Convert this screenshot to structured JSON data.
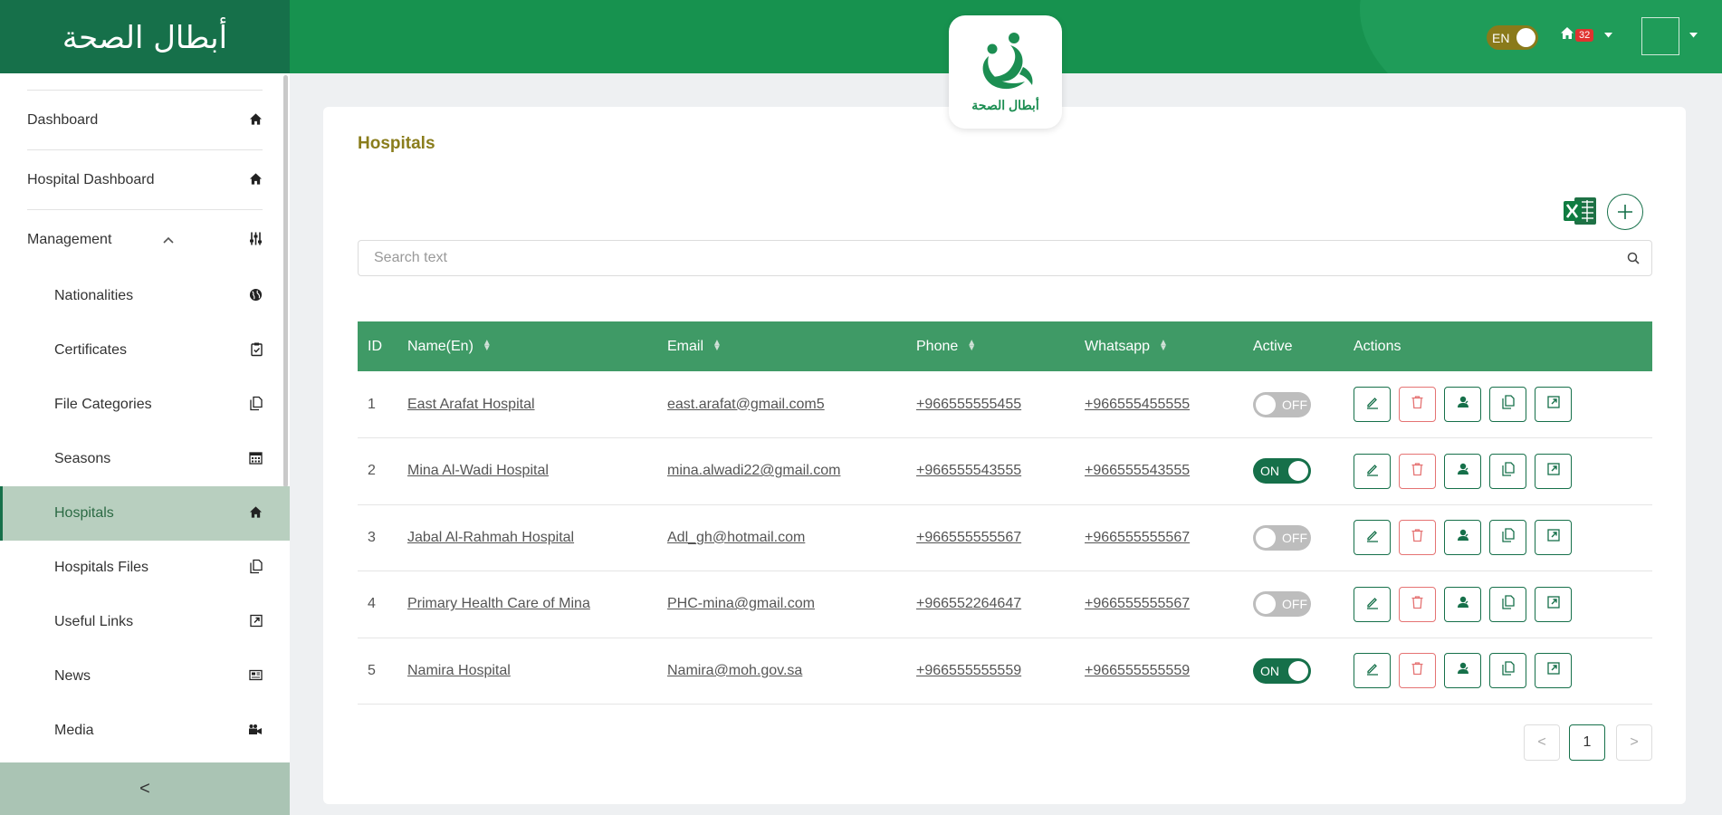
{
  "brand": {
    "logo_text": "أبطال الصحة"
  },
  "header": {
    "center_logo_text": "أبطال الصحة",
    "lang_label": "EN",
    "notification_count": "32"
  },
  "sidebar": {
    "items": [
      {
        "label": "Dashboard",
        "icon": "home-icon"
      },
      {
        "label": "Hospital Dashboard",
        "icon": "home-icon"
      },
      {
        "label": "Management",
        "icon": "sliders-icon",
        "expanded": true
      }
    ],
    "sub_items": [
      {
        "label": "Nationalities",
        "icon": "globe-icon"
      },
      {
        "label": "Certificates",
        "icon": "clipboard-check-icon"
      },
      {
        "label": "File Categories",
        "icon": "files-icon"
      },
      {
        "label": "Seasons",
        "icon": "calendar-icon"
      },
      {
        "label": "Hospitals",
        "icon": "home-icon",
        "active": true
      },
      {
        "label": "Hospitals Files",
        "icon": "files-icon"
      },
      {
        "label": "Useful Links",
        "icon": "external-link-icon"
      },
      {
        "label": "News",
        "icon": "newspaper-icon"
      },
      {
        "label": "Media",
        "icon": "video-camera-icon"
      }
    ],
    "collapse_label": "<"
  },
  "main": {
    "title": "Hospitals",
    "search": {
      "placeholder": "Search text",
      "value": ""
    },
    "table": {
      "columns": [
        "ID",
        "Name(En)",
        "Email",
        "Phone",
        "Whatsapp",
        "Active",
        "Actions"
      ],
      "rows": [
        {
          "id": "1",
          "name": "East Arafat Hospital",
          "email": "east.arafat@gmail.com5",
          "phone": "+966555555455",
          "whatsapp": "+966555455555",
          "active": "OFF"
        },
        {
          "id": "2",
          "name": "Mina Al-Wadi Hospital",
          "email": "mina.alwadi22@gmail.com",
          "phone": "+966555543555",
          "whatsapp": "+966555543555",
          "active": "ON"
        },
        {
          "id": "3",
          "name": "Jabal Al-Rahmah Hospital",
          "email": "Adl_gh@hotmail.com",
          "phone": "+966555555567",
          "whatsapp": "+966555555567",
          "active": "OFF"
        },
        {
          "id": "4",
          "name": "Primary Health Care of Mina",
          "email": "PHC-mina@gmail.com",
          "phone": "+966552264647",
          "whatsapp": "+966555555567",
          "active": "OFF"
        },
        {
          "id": "5",
          "name": "Namira Hospital",
          "email": "Namira@moh.gov.sa",
          "phone": "+966555555559",
          "whatsapp": "+966555555559",
          "active": "ON"
        }
      ]
    },
    "pagination": {
      "current_page": "1",
      "prev": "<",
      "next": ">"
    }
  },
  "colors": {
    "primary": "#16704a",
    "header_bg": "#17924f",
    "table_header": "#3f9a66",
    "title": "#8a7d1c",
    "delete": "#e57373"
  }
}
